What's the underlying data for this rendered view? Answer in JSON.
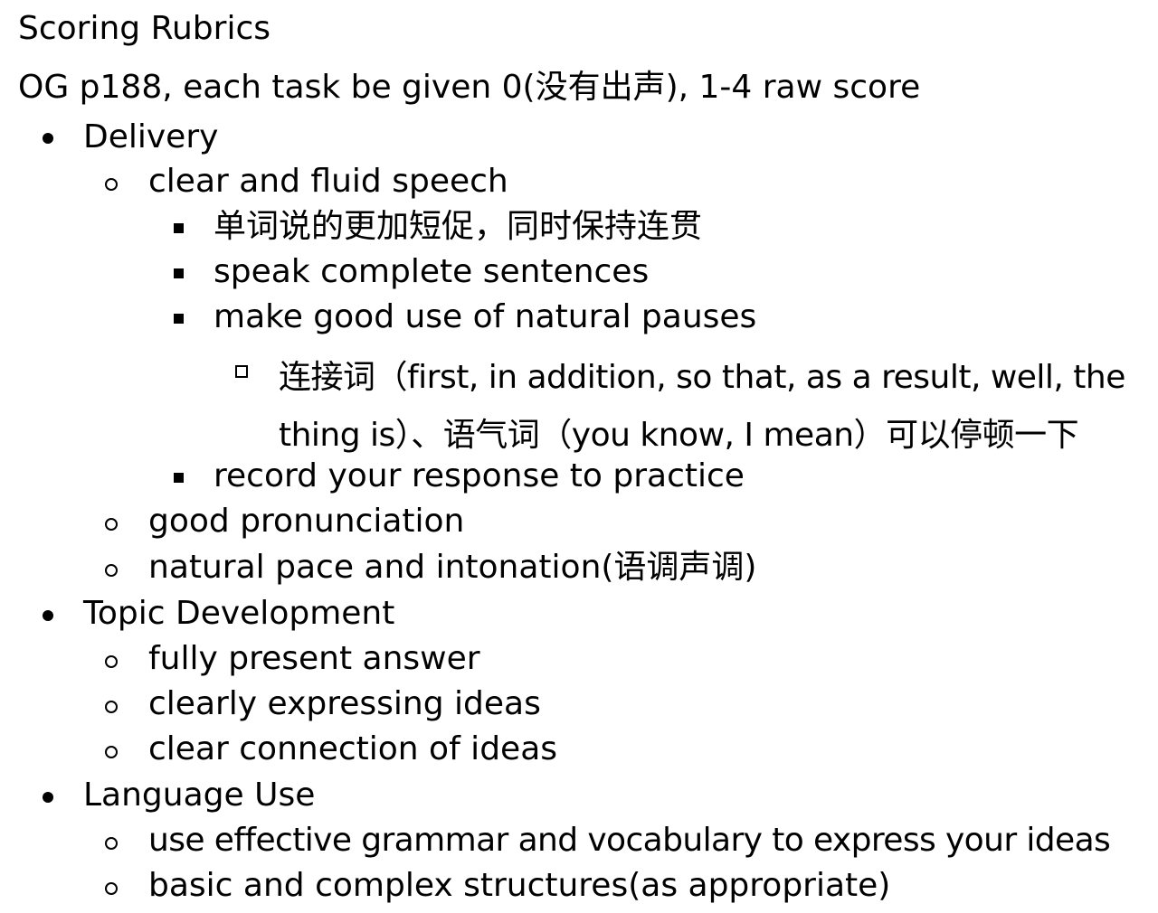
{
  "document": {
    "title": "Scoring Rubrics",
    "intro": "OG p188, each task be given 0(没有出声), 1-4 raw score",
    "delivery": {
      "label": "Delivery",
      "clear_fluid": {
        "label": "clear and fluid speech",
        "items": [
          "单词说的更加短促，同时保持连贯",
          "speak complete sentences",
          "make good use of natural pauses",
          "record your response to practice"
        ],
        "pause_detail": "连接词（first, in addition, so that, as a result, well, the thing is）、语气词（you know, I mean）可以停顿一下"
      },
      "items": [
        "good pronunciation",
        "natural pace and intonation(语调声调)"
      ]
    },
    "topic_development": {
      "label": "Topic Development",
      "items": [
        "fully present answer",
        "clearly expressing ideas",
        "clear connection of ideas"
      ]
    },
    "language_use": {
      "label": "Language Use",
      "items": [
        "use effective grammar and vocabulary to express your ideas",
        "basic and complex structures(as appropriate)"
      ]
    }
  }
}
